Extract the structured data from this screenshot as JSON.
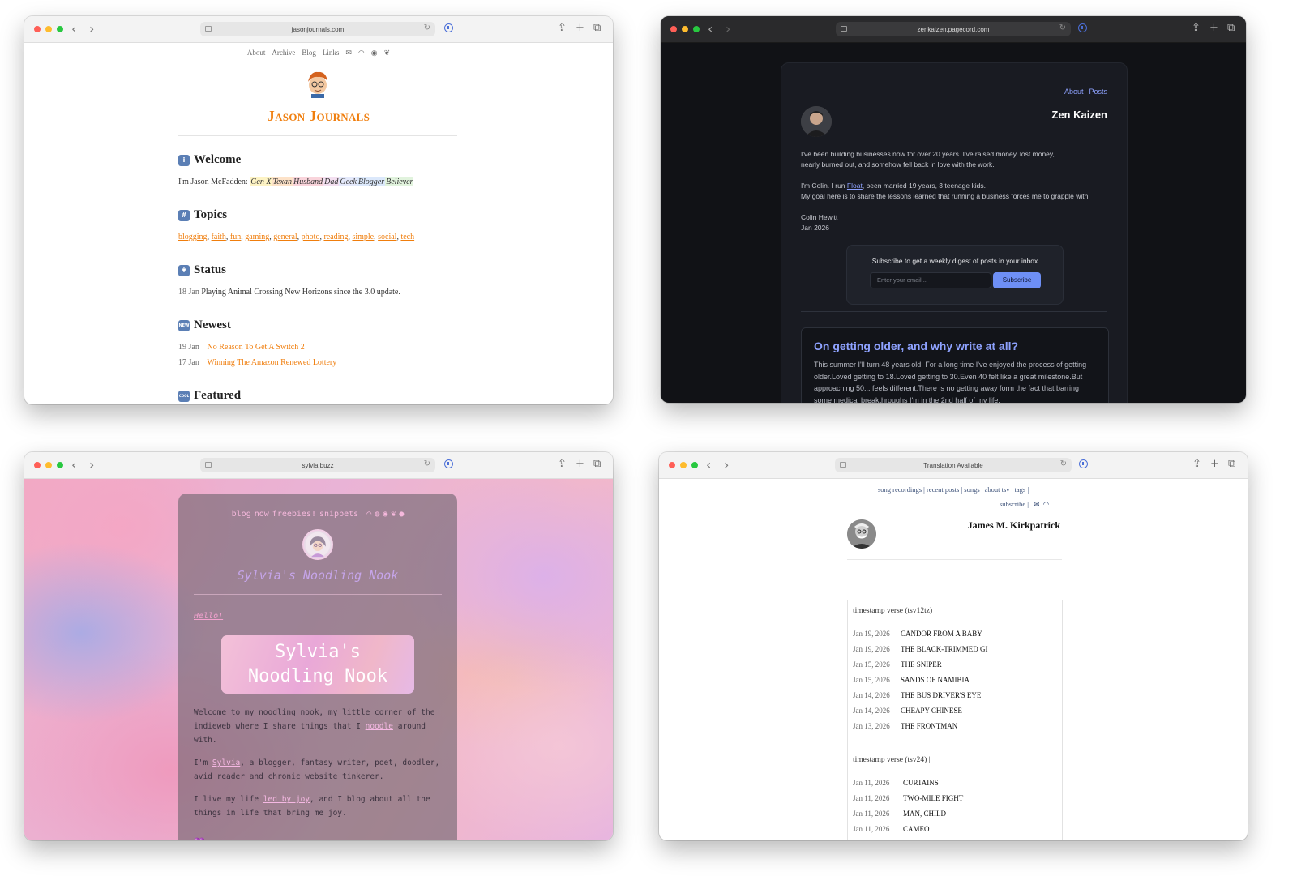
{
  "windows": {
    "jason": {
      "url": "jasonjournals.com",
      "nav": [
        "About",
        "Archive",
        "Blog",
        "Links"
      ],
      "title": "Jason Journals",
      "welcome": {
        "heading": "Welcome",
        "intro": "I'm Jason McFadden:",
        "tags": [
          {
            "label": "Gen X",
            "color": "#fdf3c4"
          },
          {
            "label": "Texan",
            "color": "#fde2c8"
          },
          {
            "label": "Husband",
            "color": "#f9d4db"
          },
          {
            "label": "Dad",
            "color": "#f3dff0"
          },
          {
            "label": "Geek",
            "color": "#e4e9fb"
          },
          {
            "label": "Blogger",
            "color": "#dbe8fb"
          },
          {
            "label": "Believer",
            "color": "#e1f3dd"
          }
        ]
      },
      "topics": {
        "heading": "Topics",
        "items": [
          "blogging",
          "faith",
          "fun",
          "gaming",
          "general",
          "photo",
          "reading",
          "simple",
          "social",
          "tech"
        ]
      },
      "status": {
        "heading": "Status",
        "date": "18 Jan",
        "text": "Playing Animal Crossing New Horizons since the 3.0 update."
      },
      "newest": {
        "heading": "Newest",
        "items": [
          {
            "date": "19 Jan",
            "title": "No Reason To Get A Switch 2"
          },
          {
            "date": "17 Jan",
            "title": "Winning The Amazon Renewed Lottery"
          }
        ]
      },
      "featured": {
        "heading": "Featured"
      },
      "icon_labels": {
        "new": "NEW",
        "cool": "COOL"
      },
      "accent": "#f07e0d"
    },
    "zen": {
      "url": "zenkaizen.pagecord.com",
      "nav": [
        "About",
        "Posts"
      ],
      "name": "Zen Kaizen",
      "bio1": "I've been building businesses now for over 20 years. I've raised money, lost money,",
      "bio2": "nearly burned out, and somehow fell back in love with the work.",
      "bio3_pre": "I'm Colin. I run",
      "bio3_link": "Float",
      "bio3_post": ", been married 19 years, 3 teenage kids.",
      "bio4": "My goal here is to share the lessons learned that running a business forces me to grapple with.",
      "sign_name": "Colin Hewitt",
      "sign_date": "Jan 2026",
      "subscribe": {
        "title": "Subscribe to get a weekly digest of posts in your inbox",
        "placeholder": "Enter your email...",
        "button": "Subscribe"
      },
      "post": {
        "title": "On getting older, and why write at all?",
        "body": "This summer I'll turn 48 years old. For a long time I've enjoyed the process of getting older.Loved getting to 18.Loved getting to 30.Even 40 felt like a great milestone.But approaching 50... feels different.There is no getting away form the fact that barring some medical breakthroughs I'm in the 2nd half of my life."
      },
      "accent": "#8ea2ff"
    },
    "sylvia": {
      "url": "sylvia.buzz",
      "nav": [
        "blog",
        "now",
        "freebies!",
        "snippets"
      ],
      "title": "Sylvia's Noodling Nook",
      "hello": "Hello!",
      "banner_line1": "Sylvia's",
      "banner_line2": "Noodling Nook",
      "p1_pre": "Welcome to my noodling nook, my little corner of the indieweb where I share things that I",
      "p1_link": "noodle",
      "p1_post": "around with.",
      "p2_pre": "I'm",
      "p2_link": "Sylvia",
      "p2_post": ", a blogger, fantasy writer, poet, doodler, avid reader and chronic website tinkerer.",
      "p3_pre": "I live my life",
      "p3_link": "led by joy",
      "p3_post": ", and I blog about all the things in life that bring me joy.",
      "heart": "💜",
      "accent": "#f3a2cf"
    },
    "james": {
      "url": "Translation Available",
      "nav1": [
        "song recordings |",
        "recent posts |",
        "songs |",
        "about tsv |",
        "tags |"
      ],
      "nav2": "subscribe |",
      "name": "James M. Kirkpatrick",
      "section1": {
        "title": "timestamp verse (tsv12tz) |",
        "items": [
          {
            "date": "Jan 19, 2026",
            "title": "CANDOR FROM A BABY"
          },
          {
            "date": "Jan 19, 2026",
            "title": "THE BLACK-TRIMMED GI"
          },
          {
            "date": "Jan 15, 2026",
            "title": "THE SNIPER"
          },
          {
            "date": "Jan 15, 2026",
            "title": "SANDS OF NAMIBIA"
          },
          {
            "date": "Jan 14, 2026",
            "title": "THE BUS DRIVER'S EYE"
          },
          {
            "date": "Jan 14, 2026",
            "title": "CHEAPY CHINESE"
          },
          {
            "date": "Jan 13, 2026",
            "title": "THE FRONTMAN"
          }
        ]
      },
      "section2": {
        "title": "timestamp verse (tsv24) |",
        "items": [
          {
            "date": "Jan 11, 2026",
            "title": "CURTAINS"
          },
          {
            "date": "Jan 11, 2026",
            "title": "TWO-MILE FIGHT"
          },
          {
            "date": "Jan 11, 2026",
            "title": "MAN, CHILD"
          },
          {
            "date": "Jan 11, 2026",
            "title": "CAMEO"
          }
        ]
      }
    }
  }
}
